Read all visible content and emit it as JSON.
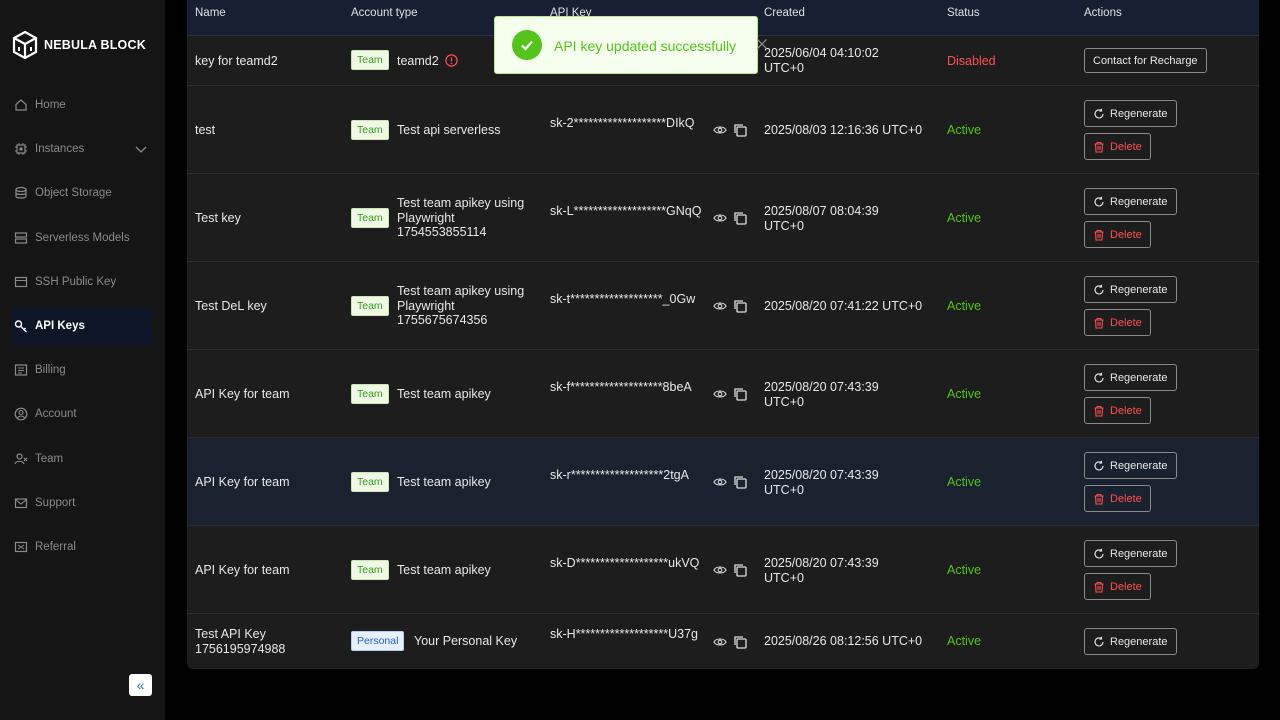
{
  "brand": {
    "name": "NEBULA BLOCK"
  },
  "sidebar": {
    "items": [
      {
        "label": "Home",
        "icon": "home-icon"
      },
      {
        "label": "Instances",
        "icon": "chip-icon"
      },
      {
        "label": "Object Storage",
        "icon": "database-icon"
      },
      {
        "label": "Serverless Models",
        "icon": "server-icon"
      },
      {
        "label": "SSH Public Key",
        "icon": "ssh-icon"
      },
      {
        "label": "API Keys",
        "icon": "key-icon"
      },
      {
        "label": "Billing",
        "icon": "billing-icon"
      },
      {
        "label": "Account",
        "icon": "account-icon"
      },
      {
        "label": "Team",
        "icon": "team-icon"
      },
      {
        "label": "Support",
        "icon": "mail-icon"
      },
      {
        "label": "Referral",
        "icon": "referral-icon"
      }
    ],
    "active": "API Keys",
    "collapse_label": "«"
  },
  "table": {
    "headers": {
      "name": "Name",
      "account_type": "Account type",
      "api_key": "API Key",
      "created": "Created",
      "status": "Status",
      "actions": "Actions"
    },
    "rows": [
      {
        "name": "key for teamd2",
        "badge": "Team",
        "account": "teamd2",
        "key": "",
        "created": "2025/06/04 04:10:02 UTC+0",
        "status": "Disabled",
        "action1": "Contact for Recharge",
        "action2": ""
      },
      {
        "name": "test",
        "badge": "Team",
        "account": "Test api serverless",
        "key": "sk-2*******************DIkQ",
        "created": "2025/08/03 12:16:36 UTC+0",
        "status": "Active",
        "action1": "Regenerate",
        "action2": "Delete"
      },
      {
        "name": "Test key",
        "badge": "Team",
        "account": "Test team apikey using Playwright 1754553855114",
        "key": "sk-L*******************GNqQ",
        "created": "2025/08/07 08:04:39 UTC+0",
        "status": "Active",
        "action1": "Regenerate",
        "action2": "Delete"
      },
      {
        "name": "Test DeL key",
        "badge": "Team",
        "account": "Test team apikey using Playwright 1755675674356",
        "key": "sk-t*******************_0Gw",
        "created": "2025/08/20 07:41:22 UTC+0",
        "status": "Active",
        "action1": "Regenerate",
        "action2": "Delete"
      },
      {
        "name": "API Key for team",
        "badge": "Team",
        "account": "Test team apikey",
        "key": "sk-f*******************8beA",
        "created": "2025/08/20 07:43:39 UTC+0",
        "status": "Active",
        "action1": "Regenerate",
        "action2": "Delete"
      },
      {
        "name": "API Key for team",
        "badge": "Team",
        "account": "Test team apikey",
        "key": "sk-r*******************2tgA",
        "created": "2025/08/20 07:43:39 UTC+0",
        "status": "Active",
        "action1": "Regenerate",
        "action2": "Delete"
      },
      {
        "name": "API Key for team",
        "badge": "Team",
        "account": "Test team apikey",
        "key": "sk-D*******************ukVQ",
        "created": "2025/08/20 07:43:39 UTC+0",
        "status": "Active",
        "action1": "Regenerate",
        "action2": "Delete"
      },
      {
        "name": "Test API Key 1756195974988",
        "badge": "Personal",
        "account": "Your Personal Key",
        "key": "sk-H*******************U37g",
        "created": "2025/08/26 08:12:56 UTC+0",
        "status": "Active",
        "action1": "Regenerate",
        "action2": ""
      }
    ]
  },
  "toast": {
    "message": "API key updated successfully"
  },
  "colors": {
    "accent": "#2a66d8",
    "success": "#52c41a",
    "danger": "#ff4d4f"
  }
}
